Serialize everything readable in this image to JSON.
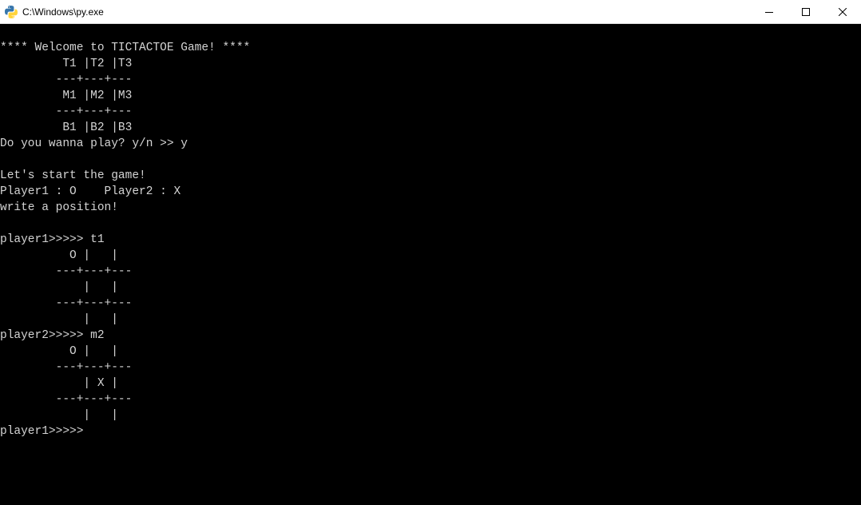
{
  "window": {
    "title": "C:\\Windows\\py.exe"
  },
  "terminal": {
    "lines": [
      "**** Welcome to TICTACTOE Game! ****",
      "         T1 |T2 |T3",
      "        ---+---+---",
      "         M1 |M2 |M3",
      "        ---+---+---",
      "         B1 |B2 |B3",
      "Do you wanna play? y/n >> y",
      "",
      "Let's start the game!",
      "Player1 : O    Player2 : X",
      "write a position!",
      "",
      "player1>>>>> t1",
      "          O |   |",
      "        ---+---+---",
      "            |   |",
      "        ---+---+---",
      "            |   |",
      "player2>>>>> m2",
      "          O |   |",
      "        ---+---+---",
      "            | X |",
      "        ---+---+---",
      "            |   |",
      "player1>>>>>"
    ]
  }
}
